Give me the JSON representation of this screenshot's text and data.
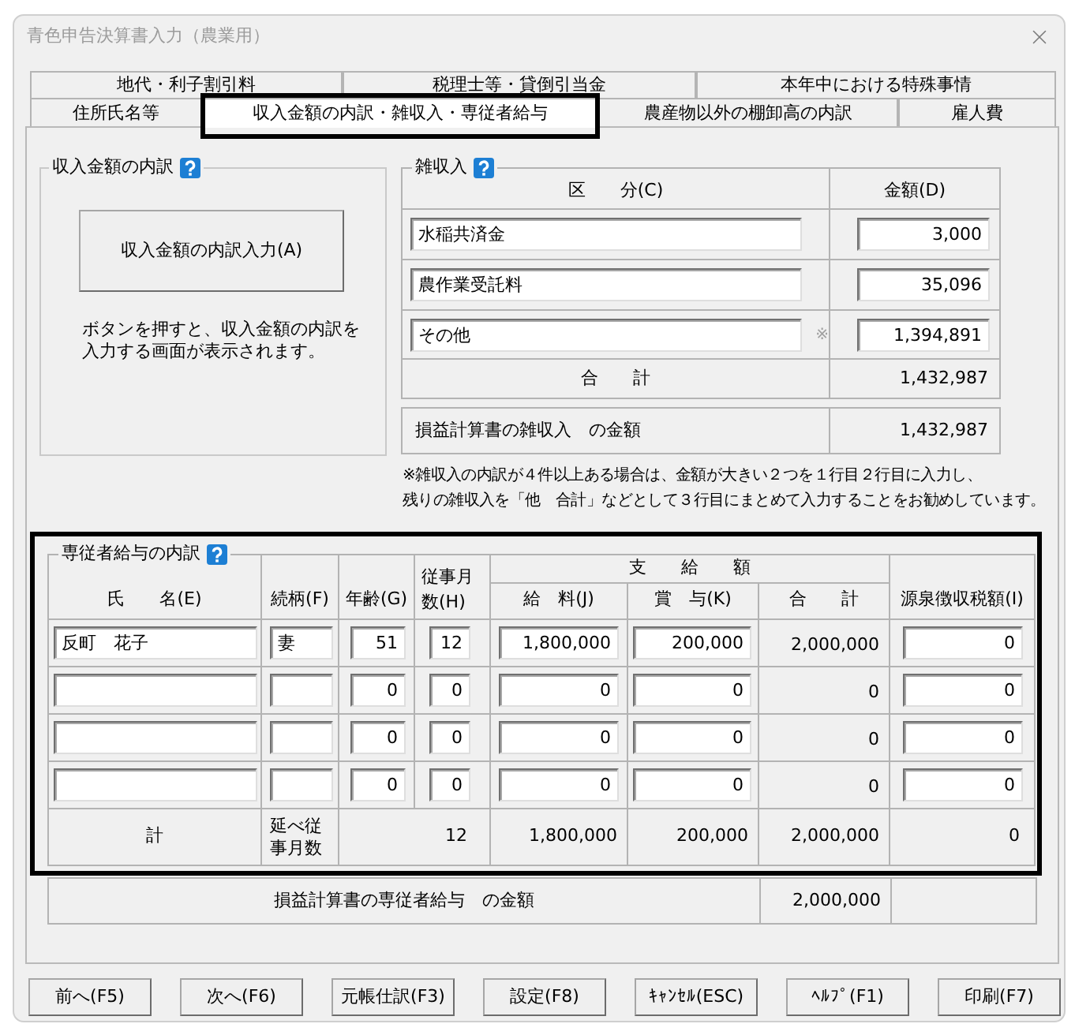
{
  "window": {
    "title": "青色申告決算書入力（農業用）"
  },
  "tab_rows": [
    {
      "tabs": [
        {
          "label": "地代・利子割引料",
          "selected": false,
          "highlighted": false
        },
        {
          "label": "税理士等・貸倒引当金",
          "selected": false,
          "highlighted": false
        },
        {
          "label": "本年中における特殊事情",
          "selected": false,
          "highlighted": false
        }
      ]
    },
    {
      "tabs": [
        {
          "label": "住所氏名等",
          "selected": false,
          "highlighted": false
        },
        {
          "label": "収入金額の内訳・雑収入・専従者給与",
          "selected": true,
          "highlighted": true
        },
        {
          "label": "農産物以外の棚卸高の内訳",
          "selected": false,
          "highlighted": false
        },
        {
          "label": "雇人費",
          "selected": false,
          "highlighted": false
        }
      ]
    }
  ],
  "income_breakdown": {
    "title": "収入金額の内訳",
    "button": "収入金額の内訳入力(A)",
    "description_lines": [
      "ボタンを押すと、収入金額の内訳を",
      "入力する画面が表示されます。"
    ]
  },
  "misc_income": {
    "title": "雑収入",
    "columns": [
      "区　　分(C)",
      "金額(D)"
    ],
    "rows": [
      {
        "category": "水稲共済金",
        "amount": "3,000"
      },
      {
        "category": "農作業受託料",
        "amount": "35,096"
      },
      {
        "category": "その他",
        "mark": "※",
        "amount": "1,394,891"
      }
    ],
    "total": {
      "label": "合　　計",
      "amount": "1,432,987"
    },
    "pl_total": {
      "label": "損益計算書の雑収入　の金額",
      "amount": "1,432,987"
    },
    "note_lines": [
      "※雑収入の内訳が４件以上ある場合は、金額が大きい２つを１行目２行目に入力し、",
      "残りの雑収入を「他　合計」などとして３行目にまとめて入力することをお勧めしています。"
    ]
  },
  "employees": {
    "title": "専従者給与の内訳",
    "highlighted": true,
    "columns": [
      "氏　　名(E)",
      "続柄(F)",
      "年齢(G)",
      "従事月数(H)",
      "給　料(J)",
      "賞　与(K)",
      "合　　計",
      "源泉徴収税額(I)"
    ],
    "group_header": "支　　給　　額",
    "rows": [
      {
        "name": "反町　花子",
        "relation": "妻",
        "age": "51",
        "months": "12",
        "salary": "1,800,000",
        "bonus": "200,000",
        "total": "2,000,000",
        "withholding": "0"
      },
      {
        "age": "0",
        "months": "0",
        "salary": "0",
        "bonus": "0",
        "total": "0",
        "withholding": "0"
      },
      {
        "age": "0",
        "months": "0",
        "salary": "0",
        "bonus": "0",
        "total": "0",
        "withholding": "0"
      },
      {
        "age": "0",
        "months": "0",
        "salary": "0",
        "bonus": "0",
        "total": "0",
        "withholding": "0"
      }
    ],
    "total": {
      "label": "計",
      "months_label": "延べ従事月数",
      "months": "12",
      "salary": "1,800,000",
      "bonus": "200,000",
      "total": "2,000,000",
      "withholding": "0"
    },
    "pl_total": {
      "label": "損益計算書の専従者給与　の金額",
      "amount": "2,000,000"
    }
  },
  "buttons": [
    "前へ(F5)",
    "次へ(F6)",
    "元帳仕訳(F3)",
    "設定(F8)",
    "ｷｬﾝｾﾙ(ESC)",
    "ﾍﾙﾌﾟ(F1)",
    "印刷(F7)"
  ]
}
